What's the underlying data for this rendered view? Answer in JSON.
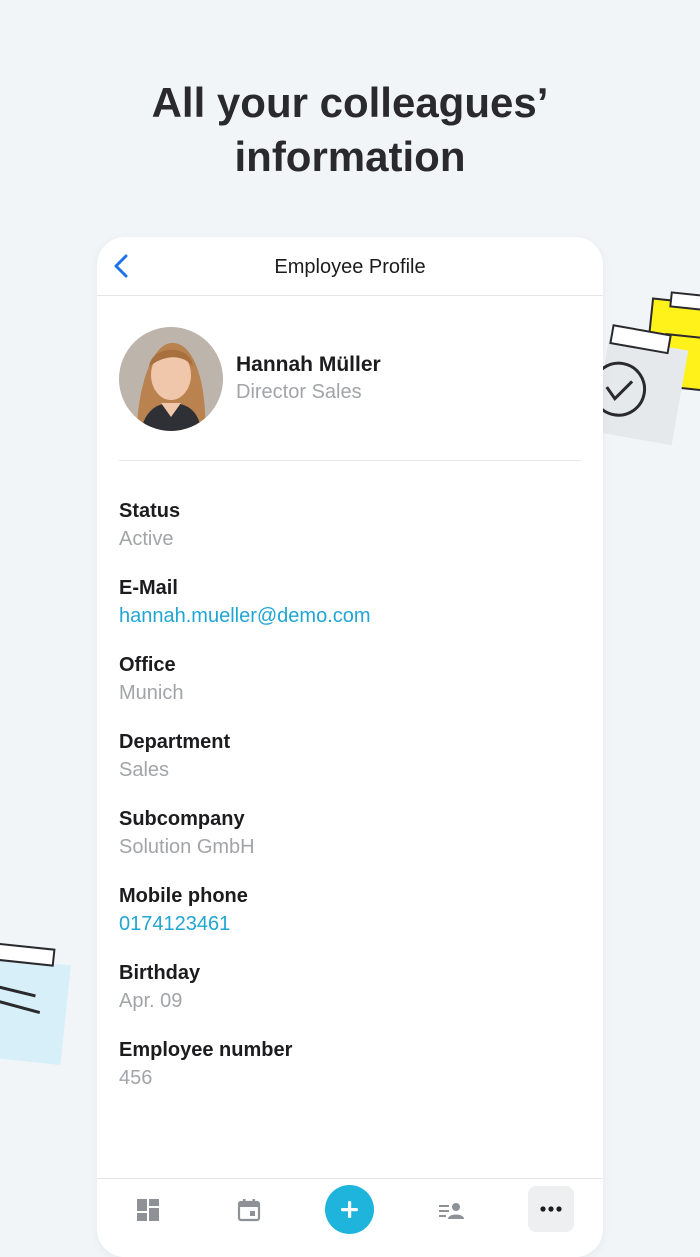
{
  "headline": {
    "line1": "All your colleagues’",
    "line2": "information"
  },
  "colors": {
    "background": "#f2f5f8",
    "accent": "#1fb4dc",
    "link": "#21a6d4",
    "muted_text": "#a2a4a8",
    "back_arrow": "#1a73e8"
  },
  "header": {
    "back_icon": "chevron-left-icon",
    "title": "Employee Profile"
  },
  "profile": {
    "name": "Hannah Müller",
    "role": "Director Sales"
  },
  "fields": [
    {
      "label": "Status",
      "value": "Active"
    },
    {
      "label": "E-Mail",
      "value": "hannah.mueller@demo.com"
    },
    {
      "label": "Office",
      "value": "Munich"
    },
    {
      "label": "Department",
      "value": "Sales"
    },
    {
      "label": "Subcompany",
      "value": "Solution GmbH"
    },
    {
      "label": "Mobile phone",
      "value": "0174123461"
    },
    {
      "label": "Birthday",
      "value": "Apr. 09"
    },
    {
      "label": "Employee number",
      "value": "456"
    }
  ],
  "tabbar": {
    "items": [
      {
        "icon": "dashboard-icon"
      },
      {
        "icon": "calendar-icon"
      },
      {
        "icon": "plus-icon"
      },
      {
        "icon": "people-list-icon"
      },
      {
        "icon": "more-icon"
      }
    ]
  }
}
